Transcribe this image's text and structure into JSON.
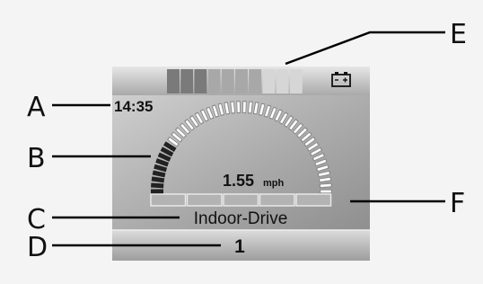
{
  "labels": {
    "a": "A",
    "b": "B",
    "c": "C",
    "d": "D",
    "e": "E",
    "f": "F"
  },
  "display": {
    "clock": "14:35",
    "speed_value": "1.55",
    "speed_unit": "mph",
    "drive_mode": "Indoor-Drive",
    "profile_number": "1",
    "battery_icon": "battery-icon",
    "battery_fraction": 0.7,
    "speed_fraction": 0.15
  },
  "colors": {
    "screen_top": "#c9c9c9",
    "screen_bottom": "#9c9c9c",
    "battery_dark": "#7a7a7a",
    "battery_mid": "#a8a8a8",
    "battery_light": "#d6d6d6",
    "gauge_active": "#222222",
    "gauge_inactive": "#ffffff",
    "status_bar": "#bdbdbd"
  }
}
